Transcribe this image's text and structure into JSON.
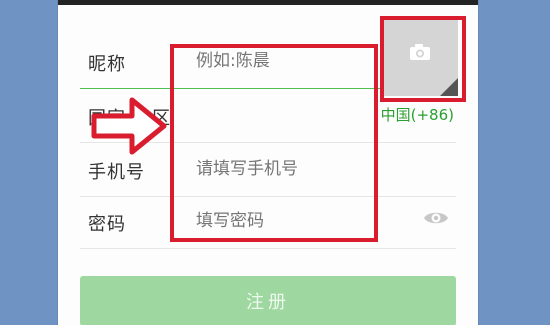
{
  "colors": {
    "background": "#6f93c2",
    "accent_green": "#4cc04f",
    "country_text": "#2b9f2f",
    "highlight_red": "#d91c2e",
    "button_green": "#9ed8a0"
  },
  "form": {
    "nickname": {
      "label": "昵称",
      "placeholder": "例如:陈晨"
    },
    "country": {
      "label": "国家/地区",
      "value": "中国(+86)"
    },
    "phone": {
      "label": "手机号",
      "placeholder": "请填写手机号"
    },
    "password": {
      "label": "密码",
      "placeholder": "填写密码",
      "toggle_icon": "eye-icon"
    }
  },
  "avatar": {
    "icon": "camera-icon"
  },
  "actions": {
    "register_label": "注册"
  }
}
